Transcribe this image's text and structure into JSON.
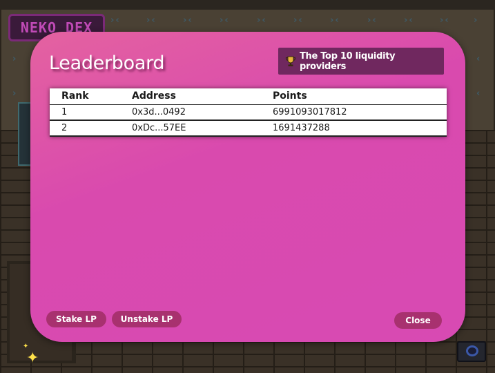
{
  "scene": {
    "logo_text": "NEKO DEX",
    "colors": {
      "wall": "#4a4134",
      "bricks": "#3a3127",
      "logo_border": "#7b2a78"
    }
  },
  "modal": {
    "title": "Leaderboard",
    "badge": {
      "icon": "trophy-icon",
      "text": "The Top 10 liquidity providers"
    },
    "colors": {
      "background": "#d94aae",
      "badge_bg": "#70285f",
      "button_bg": "#a8316f"
    },
    "table": {
      "headers": {
        "rank": "Rank",
        "address": "Address",
        "points": "Points"
      },
      "rows": [
        {
          "rank": "1",
          "address": "0x3d...0492",
          "points": "6991093017812"
        },
        {
          "rank": "2",
          "address": "0xDc...57EE",
          "points": "1691437288"
        }
      ]
    },
    "buttons": {
      "stake": "Stake LP",
      "unstake": "Unstake LP",
      "close": "Close"
    }
  },
  "decor": {
    "sparkle_icon": "sparkle-icon",
    "corner_icon": "ring-icon"
  }
}
